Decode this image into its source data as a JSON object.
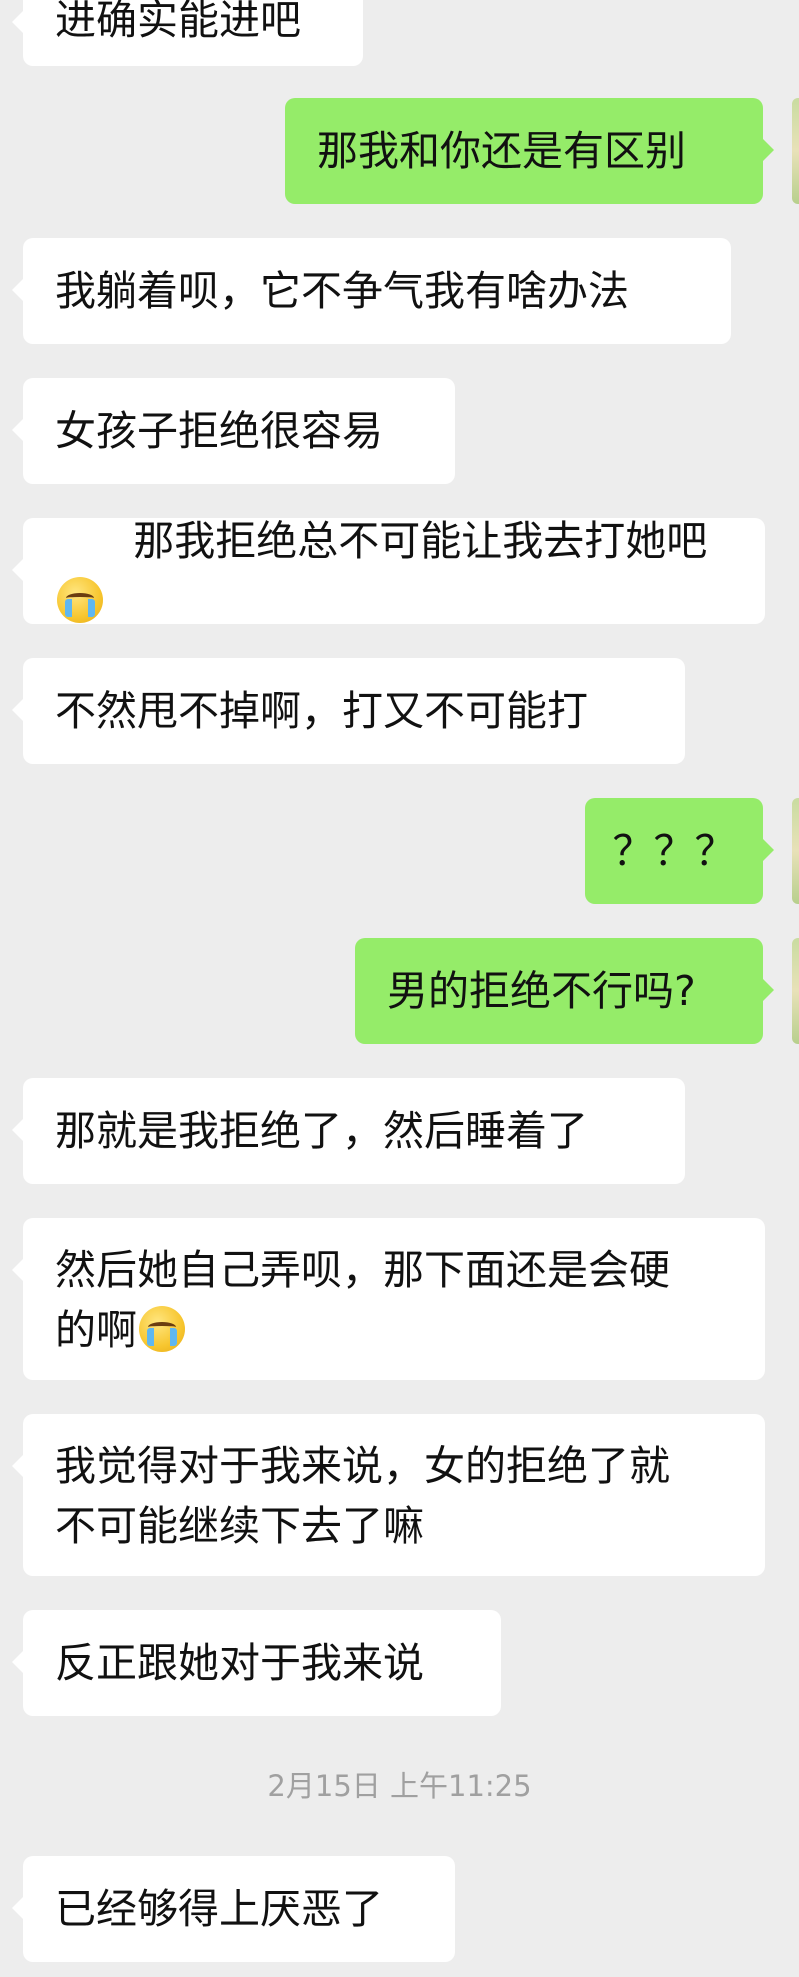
{
  "timestamp": "2月15日 上午11:25",
  "messages": [
    {
      "id": 0,
      "side": "in",
      "text": "进确实能进吧"
    },
    {
      "id": 1,
      "side": "out",
      "text": "那我和你还是有区别"
    },
    {
      "id": 2,
      "side": "in",
      "text": "我躺着呗，它不争气我有啥办法"
    },
    {
      "id": 3,
      "side": "in",
      "text": "女孩子拒绝很容易"
    },
    {
      "id": 4,
      "side": "in",
      "text": "那我拒绝总不可能让我去打她吧",
      "emoji": "crying-face-emoji"
    },
    {
      "id": 5,
      "side": "in",
      "text": "不然甩不掉啊，打又不可能打"
    },
    {
      "id": 6,
      "side": "out",
      "text": "？？？"
    },
    {
      "id": 7,
      "side": "out",
      "text": "男的拒绝不行吗?"
    },
    {
      "id": 8,
      "side": "in",
      "text": "那就是我拒绝了，然后睡着了"
    },
    {
      "id": 9,
      "side": "in",
      "text": "然后她自己弄呗，那下面还是会硬",
      "text2": "的啊",
      "emoji": "crying-face-emoji"
    },
    {
      "id": 10,
      "side": "in",
      "text": "我觉得对于我来说，女的拒绝了就",
      "text2": "不可能继续下去了嘛"
    },
    {
      "id": 11,
      "side": "in",
      "text": "反正跟她对于我来说"
    },
    {
      "id": 12,
      "side": "in",
      "text": "已经够得上厌恶了"
    }
  ]
}
